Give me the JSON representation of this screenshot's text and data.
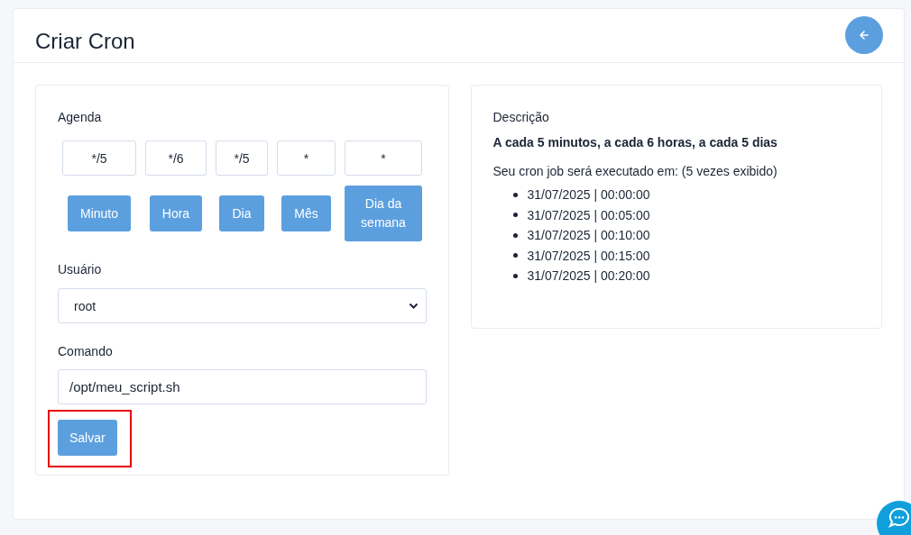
{
  "page": {
    "title": "Criar Cron"
  },
  "schedule": {
    "label": "Agenda",
    "fields": [
      {
        "value": "*/5",
        "button": "Minuto"
      },
      {
        "value": "*/6",
        "button": "Hora"
      },
      {
        "value": "*/5",
        "button": "Dia"
      },
      {
        "value": "*",
        "button": "Mês"
      },
      {
        "value": "*",
        "button": "Dia da semana"
      }
    ]
  },
  "user": {
    "label": "Usuário",
    "value": "root"
  },
  "command": {
    "label": "Comando",
    "value": "/opt/meu_script.sh"
  },
  "save_button": {
    "label": "Salvar",
    "highlighted": true
  },
  "description": {
    "label": "Descrição",
    "summary": "A cada 5 minutos, a cada 6 horas, a cada 5 dias",
    "runs_label": "Seu cron job será executado em: (5 vezes exibido)",
    "runs": [
      "31/07/2025 | 00:00:00",
      "31/07/2025 | 00:05:00",
      "31/07/2025 | 00:10:00",
      "31/07/2025 | 00:15:00",
      "31/07/2025 | 00:20:00"
    ]
  }
}
